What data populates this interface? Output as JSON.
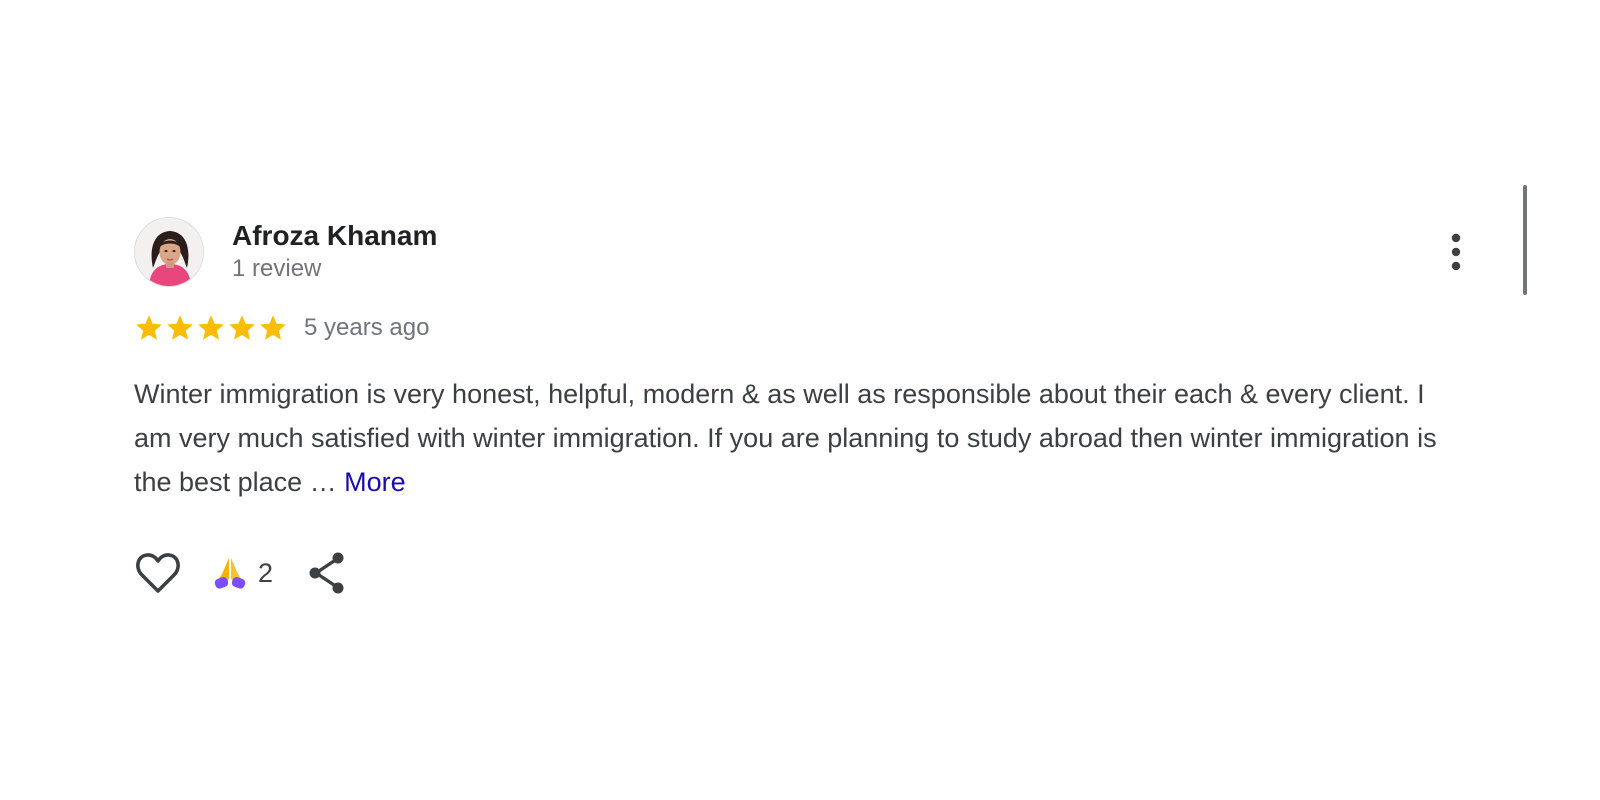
{
  "review": {
    "author": {
      "name": "Afroza Khanam",
      "review_count": "1 review",
      "avatar_icon": "user-photo"
    },
    "rating": 5,
    "rating_max": 5,
    "timestamp": "5 years ago",
    "text": "Winter immigration is very honest, helpful, modern & as well as responsible about their each & every client. I am very much satisfied with winter immigration. If you are planning to study abroad then winter immigration is the best place …",
    "more_label": "More",
    "reactions": {
      "like_icon": "heart-outline-icon",
      "reaction_emoji": "🙏",
      "reaction_count": "2",
      "share_icon": "share-icon"
    },
    "menu_icon": "more-vert-icon"
  },
  "colors": {
    "star": "#fbbc04",
    "link": "#1a0dab",
    "text": "#3c4043",
    "meta": "#70757a"
  }
}
